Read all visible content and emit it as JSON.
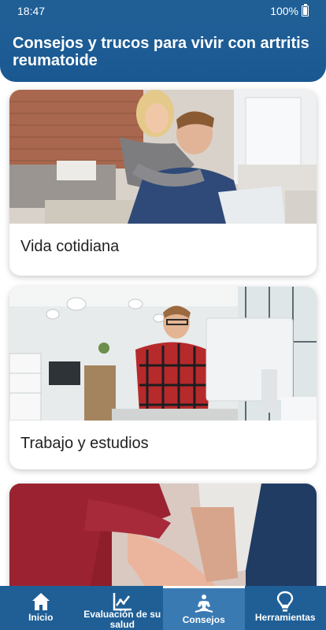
{
  "status_bar": {
    "time": "18:47",
    "battery": "100%"
  },
  "header": {
    "title": "Consejos y trucos para vivir con artritis reumatoide"
  },
  "cards": [
    {
      "label": "Vida cotidiana",
      "image": "couple-laptop-photo"
    },
    {
      "label": "Trabajo y estudios",
      "image": "man-office-computer-photo"
    },
    {
      "label": "",
      "image": "holding-hands-photo"
    }
  ],
  "nav": [
    {
      "label": "Inicio",
      "icon": "home-icon",
      "active": false
    },
    {
      "label": "Evaluación de su salud",
      "icon": "chart-icon",
      "active": false
    },
    {
      "label": "Consejos",
      "icon": "meditation-icon",
      "active": true
    },
    {
      "label": "Herramientas",
      "icon": "lightbulb-icon",
      "active": false
    }
  ],
  "colors": {
    "primary": "#1f5f96",
    "active_tab": "#3a7ab3"
  }
}
